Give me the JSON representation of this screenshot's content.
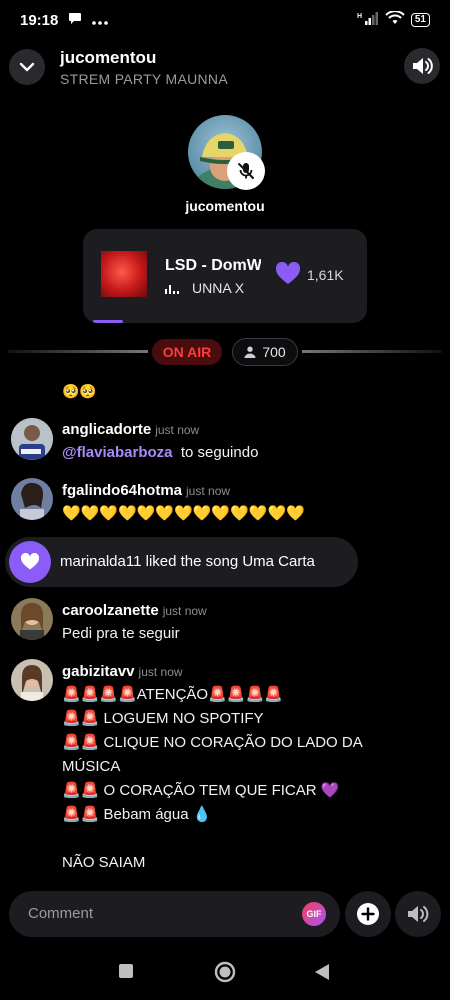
{
  "status_bar": {
    "time": "19:18",
    "battery": "51"
  },
  "header": {
    "title": "jucomentou",
    "subtitle": "STREM PARTY MAUNNA"
  },
  "host": {
    "name": "jucomentou"
  },
  "now_playing": {
    "title": "LSD - DomWa",
    "artist": "UNNA X",
    "likes": "1,61K"
  },
  "broadcast": {
    "on_air_label": "ON AIR",
    "listeners": "700"
  },
  "chat": {
    "top_emoji": "🥺🥺",
    "messages": [
      {
        "user": "anglicadorte",
        "time": "just now",
        "mention": "@flaviabarboza",
        "text": "to seguindo"
      },
      {
        "user": "fgalindo64hotma",
        "time": "just now",
        "text": "💛💛💛💛💛💛💛💛💛💛💛💛💛"
      },
      {
        "user": "caroolzanette",
        "time": "just now",
        "text": "Pedi pra te seguir"
      },
      {
        "user": "gabizitavv",
        "time": "just now",
        "lines": [
          "🚨🚨🚨🚨ATENÇÃO🚨🚨🚨🚨",
          "🚨🚨 LOGUEM NO SPOTIFY",
          "🚨🚨 CLIQUE NO CORAÇÃO DO LADO DA",
          "MÚSICA",
          "🚨🚨 O CORAÇÃO TEM QUE FICAR 💜",
          "🚨🚨 Bebam água 💧",
          "",
          "NÃO SAIAM"
        ]
      }
    ],
    "song_like_event": "marinalda11 liked the song Uma Carta"
  },
  "composer": {
    "placeholder": "Comment",
    "gif_label": "GIF"
  },
  "colors": {
    "accent": "#8b5cf6",
    "on_air": "#ff3b3b",
    "surface": "#1c1c21"
  },
  "icons": [
    "chevron-down-icon",
    "speaker-icon",
    "mic-off-icon",
    "heart-icon",
    "user-icon",
    "plus-icon",
    "sound-icon",
    "square-icon",
    "circle-icon",
    "back-icon"
  ]
}
